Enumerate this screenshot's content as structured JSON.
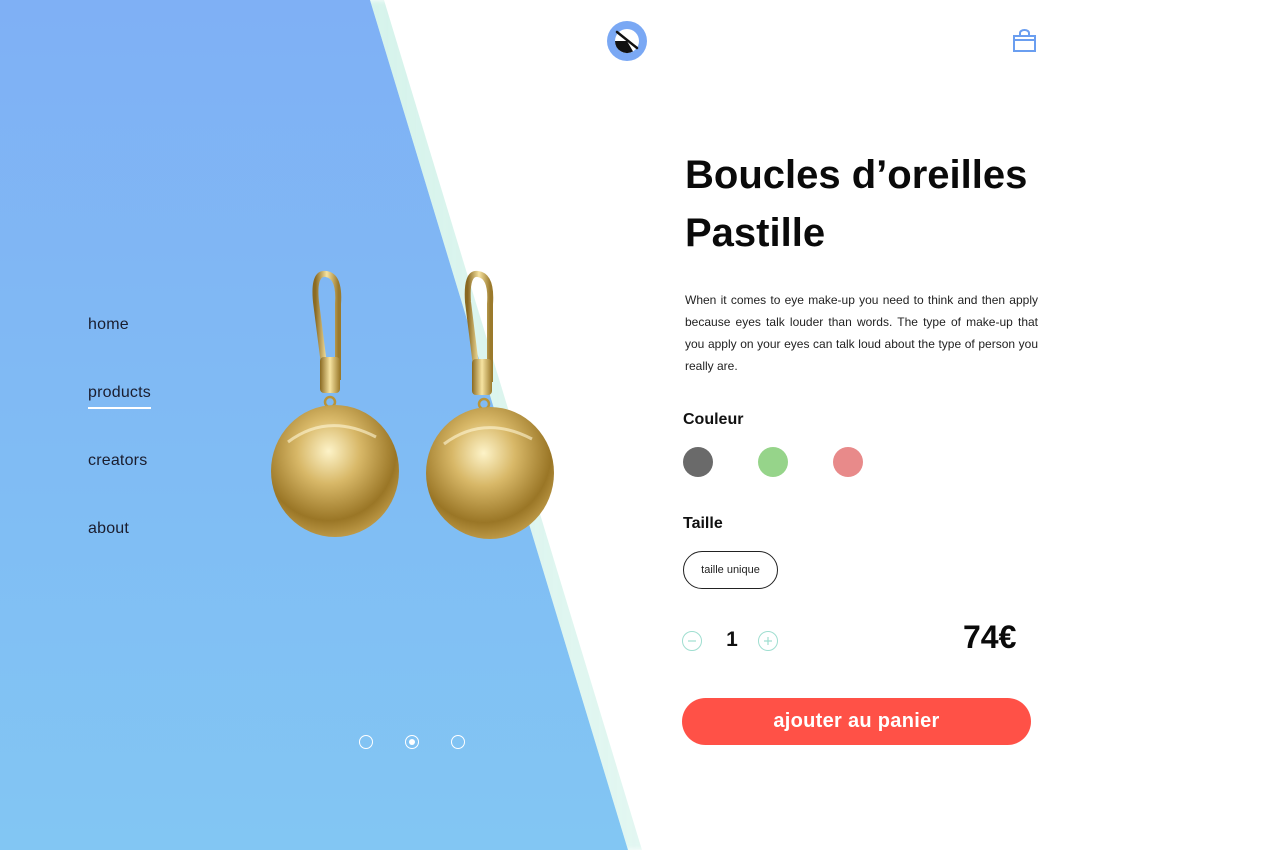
{
  "nav": {
    "items": [
      {
        "label": "home",
        "active": false
      },
      {
        "label": "products",
        "active": true
      },
      {
        "label": "creators",
        "active": false
      },
      {
        "label": "about",
        "active": false
      }
    ]
  },
  "product": {
    "title_line1": "Boucles d’oreilles",
    "title_line2": "Pastille",
    "description": "When it comes to eye make-up you need to think and then apply because eyes talk louder than words. The type of make-up that you apply on your eyes can talk loud about the type of person you really are.",
    "color_label": "Couleur",
    "colors": [
      "#6a6a6a",
      "#96d48a",
      "#e88a8a"
    ],
    "size_label": "Taille",
    "size_option": "taille unique",
    "quantity": "1",
    "price": "74€",
    "add_to_cart_label": "ajouter au panier"
  },
  "carousel": {
    "count": 3,
    "active_index": 1
  },
  "icons": {
    "logo": "brand-logo-icon",
    "cart": "shopping-bag-icon",
    "minus": "minus-circle-icon",
    "plus": "plus-circle-icon"
  },
  "theme": {
    "panel_blue": "#7fb0f5",
    "cta_red": "#ff5147",
    "accent_mint": "#9fded0"
  }
}
